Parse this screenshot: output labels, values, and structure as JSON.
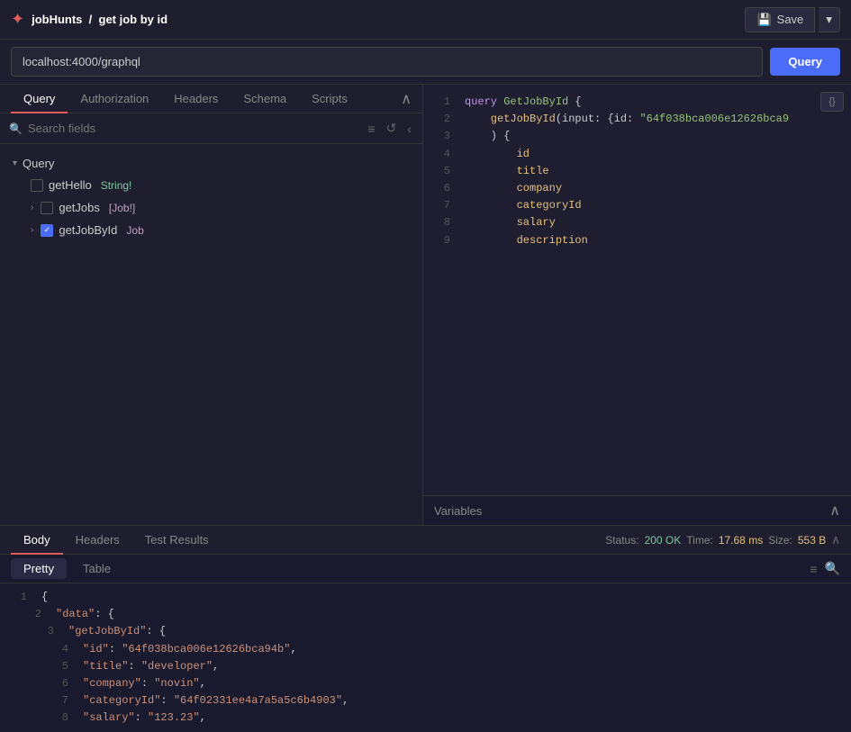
{
  "topbar": {
    "logo": "✦",
    "breadcrumb_prefix": "jobHunts",
    "breadcrumb_separator": "/",
    "breadcrumb_current": "get job by id",
    "save_label": "Save",
    "dropdown_arrow": "▾"
  },
  "url_bar": {
    "url_value": "localhost:4000/graphql",
    "query_label": "Query"
  },
  "left_tabs": {
    "items": [
      {
        "id": "query",
        "label": "Query"
      },
      {
        "id": "authorization",
        "label": "Authorization"
      },
      {
        "id": "headers",
        "label": "Headers"
      },
      {
        "id": "schema",
        "label": "Schema"
      },
      {
        "id": "scripts",
        "label": "Scripts"
      }
    ],
    "active": "query"
  },
  "search": {
    "placeholder": "Search fields",
    "filter_icon": "≡",
    "refresh_icon": "↺",
    "collapse_icon": "‹"
  },
  "query_tree": {
    "section_label": "Query",
    "chevron": "▾",
    "items": [
      {
        "id": "getHello",
        "name": "getHello",
        "type": "String!",
        "checked": false,
        "has_children": false
      },
      {
        "id": "getJobs",
        "name": "getJobs",
        "type": "[Job!]",
        "checked": false,
        "has_children": true
      },
      {
        "id": "getJobById",
        "name": "getJobById",
        "type": "Job",
        "checked": true,
        "has_children": true
      }
    ]
  },
  "editor": {
    "lines": [
      {
        "num": 1,
        "content": "query GetJobById {",
        "parts": [
          {
            "text": "query ",
            "cls": "kw-purple"
          },
          {
            "text": "GetJobById",
            "cls": "kw-green"
          },
          {
            "text": " {",
            "cls": ""
          }
        ]
      },
      {
        "num": 2,
        "content": "    getJobById(input: {id: \"64f038bca006e12626bca9",
        "parts": [
          {
            "text": "    getJobById",
            "cls": "kw-yellow"
          },
          {
            "text": "(input: ",
            "cls": ""
          },
          {
            "text": "{id: ",
            "cls": ""
          },
          {
            "text": "\"64f038bca006e12626bca9",
            "cls": "kw-green"
          }
        ]
      },
      {
        "num": 3,
        "content": "    ) {",
        "parts": [
          {
            "text": "    ) {",
            "cls": ""
          }
        ]
      },
      {
        "num": 4,
        "content": "        id",
        "parts": [
          {
            "text": "        id",
            "cls": "kw-yellow"
          }
        ]
      },
      {
        "num": 5,
        "content": "        title",
        "parts": [
          {
            "text": "        title",
            "cls": "kw-yellow"
          }
        ]
      },
      {
        "num": 6,
        "content": "        company",
        "parts": [
          {
            "text": "        company",
            "cls": "kw-yellow"
          }
        ]
      },
      {
        "num": 7,
        "content": "        categoryId",
        "parts": [
          {
            "text": "        categoryId",
            "cls": "kw-yellow"
          }
        ]
      },
      {
        "num": 8,
        "content": "        salary",
        "parts": [
          {
            "text": "        salary",
            "cls": "kw-yellow"
          }
        ]
      },
      {
        "num": 9,
        "content": "        description",
        "parts": [
          {
            "text": "        description",
            "cls": "kw-yellow"
          }
        ]
      }
    ],
    "tools": [
      "{}",
      ""
    ]
  },
  "variables": {
    "label": "Variables",
    "collapse_icon": "∧"
  },
  "bottom_tabs": {
    "items": [
      {
        "id": "body",
        "label": "Body"
      },
      {
        "id": "headers",
        "label": "Headers"
      },
      {
        "id": "test_results",
        "label": "Test Results"
      }
    ],
    "active": "body",
    "status_label": "Status:",
    "status_value": "200 OK",
    "time_label": "Time:",
    "time_value": "17.68 ms",
    "size_label": "Size:",
    "size_value": "553 B"
  },
  "response_tabs": {
    "items": [
      {
        "id": "pretty",
        "label": "Pretty"
      },
      {
        "id": "table",
        "label": "Table"
      }
    ],
    "active": "pretty",
    "filter_icon": "≡",
    "search_icon": "🔍"
  },
  "json_output": {
    "lines": [
      {
        "num": 1,
        "indent": 0,
        "content": "{"
      },
      {
        "num": 2,
        "indent": 1,
        "content": "\"data\": {"
      },
      {
        "num": 3,
        "indent": 2,
        "content": "\"getJobById\": {"
      },
      {
        "num": 4,
        "indent": 3,
        "content": "\"id\": \"64f038bca006e12626bca94b\","
      },
      {
        "num": 5,
        "indent": 3,
        "content": "\"title\": \"developer\","
      },
      {
        "num": 6,
        "indent": 3,
        "content": "\"company\": \"novin\","
      },
      {
        "num": 7,
        "indent": 3,
        "content": "\"categoryId\": \"64f02331ee4a7a5a5c6b4903\","
      },
      {
        "num": 8,
        "indent": 3,
        "content": "\"salary\": \"123.23\","
      }
    ]
  }
}
